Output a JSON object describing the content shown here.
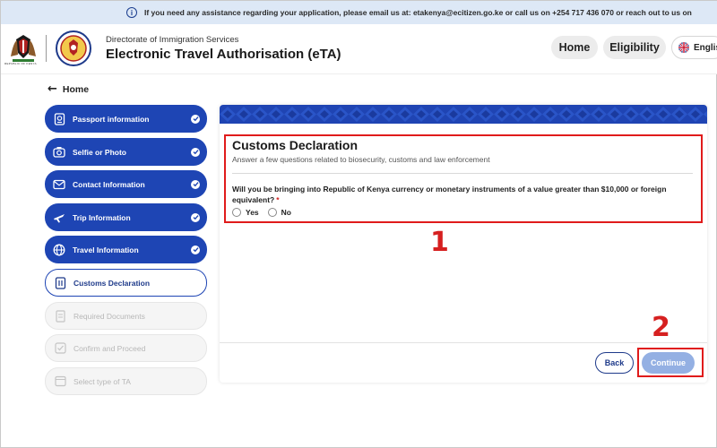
{
  "info_bar": {
    "text": "If you need any assistance regarding your application, please email us at: etakenya@ecitizen.go.ke or call us on +254 717 436 070 or reach out to us on"
  },
  "header": {
    "coat_caption": "REPUBLIC OF KENYA",
    "subtitle": "Directorate of Immigration Services",
    "title": "Electronic Travel Authorisation (eTA)",
    "nav": {
      "home": "Home",
      "eligibility": "Eligibility",
      "language": "English"
    }
  },
  "back_link": "Home",
  "steps": [
    {
      "label": "Passport information",
      "icon": "passport-icon",
      "state": "done"
    },
    {
      "label": "Selfie or Photo",
      "icon": "camera-icon",
      "state": "done"
    },
    {
      "label": "Contact Information",
      "icon": "mail-icon",
      "state": "done"
    },
    {
      "label": "Trip Information",
      "icon": "plane-icon",
      "state": "done"
    },
    {
      "label": "Travel Information",
      "icon": "globe-icon",
      "state": "done"
    },
    {
      "label": "Customs Declaration",
      "icon": "customs-icon",
      "state": "active"
    },
    {
      "label": "Required Documents",
      "icon": "documents-icon",
      "state": "pending"
    },
    {
      "label": "Confirm and Proceed",
      "icon": "confirm-icon",
      "state": "pending"
    },
    {
      "label": "Select type of TA",
      "icon": "ta-type-icon",
      "state": "pending"
    }
  ],
  "customs": {
    "title": "Customs Declaration",
    "subtitle": "Answer a few questions related to biosecurity, customs and law enforcement",
    "question": "Will you be bringing into Republic of Kenya currency or monetary instruments of a value greater than $10,000 or foreign equivalent?",
    "required_mark": "*",
    "options": {
      "yes": "Yes",
      "no": "No"
    }
  },
  "buttons": {
    "back": "Back",
    "continue": "Continue"
  },
  "annotations": {
    "one": "1",
    "two": "2"
  },
  "colors": {
    "primary": "#1e45b4",
    "annotation_red": "#e01b1b",
    "continue_disabled": "#94b0e3",
    "info_bar_bg": "#dde8f6"
  }
}
